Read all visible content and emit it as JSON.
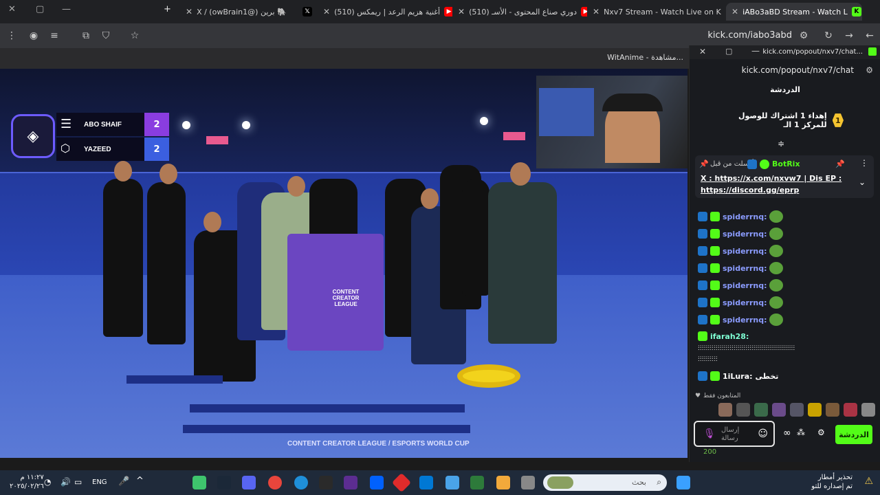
{
  "tabs": [
    {
      "label": "X / (owBrain1@) برين 🐘",
      "favicon": "x-icon"
    },
    {
      "label": "(510) أغنية هزيم الرعد | ريمكس",
      "favicon": "youtube-icon"
    },
    {
      "label": "(510) دوري صناع المحتوى - الأسـ",
      "favicon": "youtube-icon"
    },
    {
      "label": "Nxv7 Stream - Watch Live on K",
      "favicon": "kick-icon"
    },
    {
      "label": "iABo3aBD Stream - Watch L",
      "favicon": "kick-icon"
    }
  ],
  "toolbar": {
    "url": "kick.com/iabo3abd"
  },
  "bookmarks": {
    "item": "WitAnime - مشاهدة..."
  },
  "video": {
    "team1": {
      "name": "ABO SHAIF",
      "score": "2"
    },
    "team2": {
      "name": "YAZEED",
      "score": "2"
    },
    "podium_text": "CONTENT CREATOR LEAGUE",
    "footer": "CONTENT CREATOR LEAGUE / ESPORTS WORLD CUP"
  },
  "chat": {
    "popup_title": "kick.com/popout/nxv7/chat...",
    "url": "kick.com/popout/nxv7/chat",
    "title": "الدردشة",
    "goal": {
      "number": "1",
      "text": "إهداء 1 اشتراك للوصول للمركز 1 الـ"
    },
    "pinned": {
      "sent_by": "أرسلت من قبل",
      "user": "BotRix",
      "line1": "X : https://x.com/nxvw7 | Dis EP :",
      "line2": "https://discord.gg/eprp"
    },
    "messages": [
      {
        "user": "spiderrnq:"
      },
      {
        "user": "spiderrnq:"
      },
      {
        "user": "spiderrnq:"
      },
      {
        "user": "spiderrnq:"
      },
      {
        "user": "spiderrnq:"
      },
      {
        "user": "spiderrnq:"
      },
      {
        "user": "spiderrnq:"
      }
    ],
    "long_msg_user": "ifarah28:",
    "long_msg_text": "ⵗⵗⵗⵗⵗⵗⵗⵗⵗⵗⵗⵗⵗⵗⵗⵗⵗⵗⵗⵗⵗⵗⵗⵗⵗⵗⵗⵗⵗⵗⵗⵗⵗⵗⵗⵗⵗⵗⵗⵗⵗⵗⵗⵗⵗⵗⵗⵗⵗ",
    "long_msg_text2": "ⵗⵗⵗⵗⵗⵗⵗⵗⵗⵗ",
    "last_user": "1iLura:",
    "last_text": "تخطى",
    "viewers_label": "المتابعون فقط",
    "input_placeholder": "إرسال رسالة",
    "send_label": "الدردشة",
    "balance": "200"
  },
  "taskbar": {
    "time": "١١:٢٧ م",
    "date": "٢٠٢٥/٠٢/٢٦",
    "lang": "ENG",
    "search_placeholder": "بحث",
    "weather_title": "تحذير أمطار",
    "weather_sub": "تم إصداره للتو"
  },
  "colors": {
    "kick_green": "#53fc18",
    "accent_purple": "#7b4dff"
  }
}
